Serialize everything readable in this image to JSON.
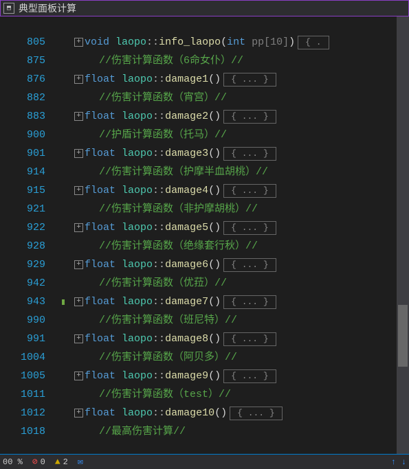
{
  "titlebar": {
    "title": "典型面板计算"
  },
  "lines": [
    {
      "num": "805",
      "fold": true,
      "type": "sig",
      "ret": "void",
      "cls": "laopo",
      "fn": "info_laopo",
      "params": "int pp[10]",
      "body": "{ . "
    },
    {
      "num": "875",
      "type": "comment",
      "text": "//伤害计算函数（6命女仆）//"
    },
    {
      "num": "876",
      "fold": true,
      "type": "sig",
      "ret": "float",
      "cls": "laopo",
      "fn": "damage1",
      "params": "",
      "body": "{ ... }"
    },
    {
      "num": "882",
      "type": "comment",
      "text": "//伤害计算函数（宵宫）//"
    },
    {
      "num": "883",
      "fold": true,
      "type": "sig",
      "ret": "float",
      "cls": "laopo",
      "fn": "damage2",
      "params": "",
      "body": "{ ... }"
    },
    {
      "num": "900",
      "type": "comment",
      "text": "//护盾计算函数（托马）//"
    },
    {
      "num": "901",
      "fold": true,
      "type": "sig",
      "ret": "float",
      "cls": "laopo",
      "fn": "damage3",
      "params": "",
      "body": "{ ... }"
    },
    {
      "num": "914",
      "type": "comment",
      "text": "//伤害计算函数（护摩半血胡桃）//"
    },
    {
      "num": "915",
      "fold": true,
      "type": "sig",
      "ret": "float",
      "cls": "laopo",
      "fn": "damage4",
      "params": "",
      "body": "{ ... }"
    },
    {
      "num": "921",
      "type": "comment",
      "text": "//伤害计算函数（非护摩胡桃）//"
    },
    {
      "num": "922",
      "fold": true,
      "type": "sig",
      "ret": "float",
      "cls": "laopo",
      "fn": "damage5",
      "params": "",
      "body": "{ ... }"
    },
    {
      "num": "928",
      "type": "comment",
      "text": "//伤害计算函数（绝缘套行秋）//"
    },
    {
      "num": "929",
      "fold": true,
      "type": "sig",
      "ret": "float",
      "cls": "laopo",
      "fn": "damage6",
      "params": "",
      "body": "{ ... }"
    },
    {
      "num": "942",
      "type": "comment",
      "text": "//伤害计算函数（优菈）//"
    },
    {
      "num": "943",
      "fold": true,
      "mark": true,
      "type": "sig",
      "ret": "float",
      "cls": "laopo",
      "fn": "damage7",
      "params": "",
      "body": "{ ... }"
    },
    {
      "num": "990",
      "type": "comment",
      "text": "//伤害计算函数（班尼特）//"
    },
    {
      "num": "991",
      "fold": true,
      "type": "sig",
      "ret": "float",
      "cls": "laopo",
      "fn": "damage8",
      "params": "",
      "body": "{ ... }"
    },
    {
      "num": "1004",
      "type": "comment",
      "text": "//伤害计算函数（阿贝多）//"
    },
    {
      "num": "1005",
      "fold": true,
      "type": "sig",
      "ret": "float",
      "cls": "laopo",
      "fn": "damage9",
      "params": "",
      "body": "{ ... }"
    },
    {
      "num": "1011",
      "type": "comment",
      "text": "//伤害计算函数（test）//"
    },
    {
      "num": "1012",
      "fold": true,
      "type": "sig",
      "ret": "float",
      "cls": "laopo",
      "fn": "damage10",
      "params": "",
      "body": "{ ... }"
    },
    {
      "num": "1018",
      "type": "comment",
      "text": "//最高伤害计算//"
    }
  ],
  "status": {
    "pct": "00 %",
    "errors": "0",
    "warnings": "2",
    "info": "",
    "spaces": ""
  }
}
